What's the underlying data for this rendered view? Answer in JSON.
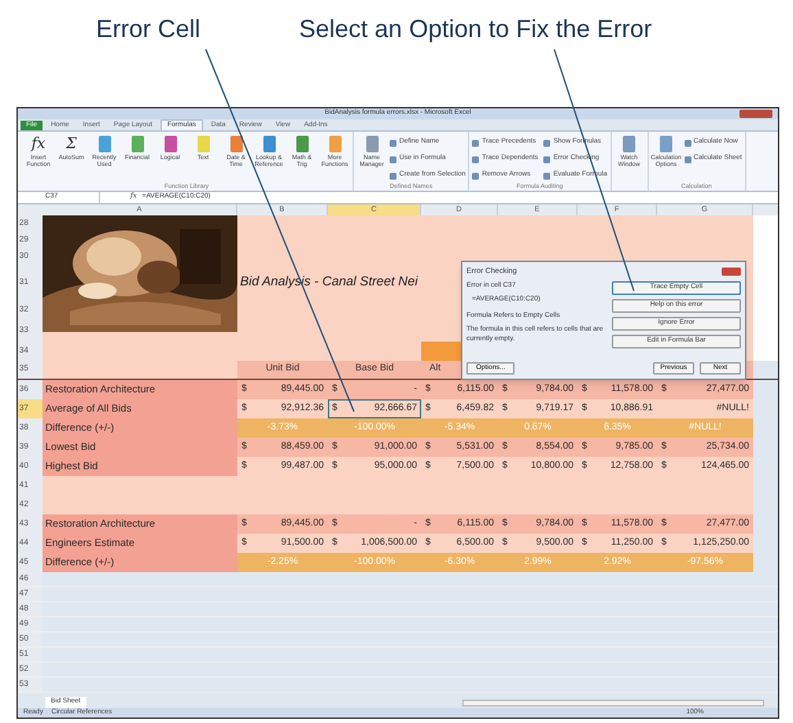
{
  "callouts": [
    "Error Cell",
    "Select an Option to Fix the Error"
  ],
  "window": {
    "title": "BidAnalysis formula errors.xlsx - Microsoft Excel"
  },
  "tabs": [
    {
      "label": "File",
      "selected": false,
      "kind": "file"
    },
    {
      "label": "Home",
      "selected": false,
      "kind": "tab"
    },
    {
      "label": "Insert",
      "selected": false,
      "kind": "tab"
    },
    {
      "label": "Page Layout",
      "selected": false,
      "kind": "tab"
    },
    {
      "label": "Formulas",
      "selected": true,
      "kind": "tab"
    },
    {
      "label": "Data",
      "selected": false,
      "kind": "tab"
    },
    {
      "label": "Review",
      "selected": false,
      "kind": "tab"
    },
    {
      "label": "View",
      "selected": false,
      "kind": "tab"
    },
    {
      "label": "Add-Ins",
      "selected": false,
      "kind": "tab"
    }
  ],
  "ribbon": {
    "groups": [
      {
        "label": "Function Library",
        "large": [
          {
            "glyph": "fx",
            "label": "Insert Function"
          },
          {
            "glyph": "Σ",
            "label": "AutoSum"
          },
          {
            "color": "#4aa3d8",
            "label": "Recently Used"
          },
          {
            "color": "#5bb05b",
            "label": "Financial"
          },
          {
            "color": "#c84fa0",
            "label": "Logical"
          },
          {
            "color": "#e8d84a",
            "label": "Text"
          },
          {
            "color": "#e8803a",
            "label": "Date & Time"
          },
          {
            "color": "#3d8fd0",
            "label": "Lookup & Reference"
          },
          {
            "color": "#4a9a4a",
            "label": "Math & Trig"
          },
          {
            "color": "#f0a040",
            "label": "More Functions"
          }
        ]
      },
      {
        "label": "Defined Names",
        "large": [
          {
            "color": "#8a9ab0",
            "label": "Name Manager"
          }
        ],
        "small": [
          "Define Name",
          "Use in Formula",
          "Create from Selection"
        ]
      },
      {
        "label": "Formula Auditing",
        "small": [
          "Trace Precedents",
          "Trace Dependents",
          "Remove Arrows",
          "Show Formulas",
          "Error Checking",
          "Evaluate Formula"
        ]
      },
      {
        "large": [
          {
            "color": "#7a9ac0",
            "label": "Watch Window"
          }
        ]
      },
      {
        "label": "Calculation",
        "large": [
          {
            "color": "#7aa0c8",
            "label": "Calculation Options"
          }
        ],
        "small": [
          "Calculate Now",
          "Calculate Sheet"
        ]
      }
    ]
  },
  "formula_bar": {
    "name_box": "C37",
    "fx": "fx",
    "formula": "=AVERAGE(C10:C20)"
  },
  "columns": [
    {
      "label": "A",
      "selected": false
    },
    {
      "label": "B",
      "selected": false
    },
    {
      "label": "C",
      "selected": true
    },
    {
      "label": "D",
      "selected": false
    },
    {
      "label": "E",
      "selected": false
    },
    {
      "label": "F",
      "selected": false
    },
    {
      "label": "G",
      "selected": false
    }
  ],
  "top_rows": [
    "28",
    "29",
    "30",
    "31",
    "32",
    "33",
    "34"
  ],
  "sheet_title": "Bid Analysis - Canal Street Nei",
  "header_row": {
    "row": "35",
    "cells": [
      "Unit Bid",
      "Base Bid",
      "Alt"
    ]
  },
  "rows": [
    {
      "row": "36",
      "kind": "salmon",
      "selected": false,
      "label": "Restoration Architecture",
      "cells": [
        [
          "$",
          "89,445.00"
        ],
        [
          "$",
          "-"
        ],
        [
          "$",
          "6,115.00"
        ],
        [
          "$",
          "9,784.00"
        ],
        [
          "$",
          "11,578.00"
        ],
        [
          "$",
          "27,477.00"
        ]
      ]
    },
    {
      "row": "37",
      "kind": "light",
      "selected": true,
      "label": "Average of All Bids",
      "cells": [
        [
          "$",
          "92,912.36"
        ],
        [
          "$",
          "92,666.67"
        ],
        [
          "$",
          "6,459.82"
        ],
        [
          "$",
          "9,719.17"
        ],
        [
          "$",
          "10,886.91"
        ],
        [
          "",
          "#NULL!"
        ]
      ]
    },
    {
      "row": "38",
      "kind": "orange",
      "selected": false,
      "label": "Difference (+/-)",
      "cells": [
        [
          "",
          "-3.73%"
        ],
        [
          "",
          "-100.00%"
        ],
        [
          "",
          "-5.34%"
        ],
        [
          "",
          "0.67%"
        ],
        [
          "",
          "6.35%"
        ],
        [
          "",
          "#NULL!"
        ]
      ]
    },
    {
      "row": "39",
      "kind": "salmon",
      "selected": false,
      "label": "Lowest Bid",
      "cells": [
        [
          "$",
          "88,459.00"
        ],
        [
          "$",
          "91,000.00"
        ],
        [
          "$",
          "5,531.00"
        ],
        [
          "$",
          "8,554.00"
        ],
        [
          "$",
          "9,785.00"
        ],
        [
          "$",
          "25,734.00"
        ]
      ]
    },
    {
      "row": "40",
      "kind": "light",
      "selected": false,
      "label": "Highest Bid",
      "cells": [
        [
          "$",
          "99,487.00"
        ],
        [
          "$",
          "95,000.00"
        ],
        [
          "$",
          "7,500.00"
        ],
        [
          "$",
          "10,800.00"
        ],
        [
          "$",
          "12,758.00"
        ],
        [
          "$",
          "124,465.00"
        ]
      ]
    },
    {
      "row": "41",
      "kind": "blank",
      "selected": false,
      "label": "",
      "cells": []
    },
    {
      "row": "42",
      "kind": "blank",
      "selected": false,
      "label": "",
      "cells": []
    },
    {
      "row": "43",
      "kind": "salmon",
      "selected": false,
      "label": "Restoration Architecture",
      "cells": [
        [
          "$",
          "89,445.00"
        ],
        [
          "$",
          "-"
        ],
        [
          "$",
          "6,115.00"
        ],
        [
          "$",
          "9,784.00"
        ],
        [
          "$",
          "11,578.00"
        ],
        [
          "$",
          "27,477.00"
        ]
      ]
    },
    {
      "row": "44",
      "kind": "light",
      "selected": false,
      "label": "Engineers Estimate",
      "cells": [
        [
          "$",
          "91,500.00"
        ],
        [
          "$",
          "1,006,500.00"
        ],
        [
          "$",
          "6,500.00"
        ],
        [
          "$",
          "9,500.00"
        ],
        [
          "$",
          "11,250.00"
        ],
        [
          "$",
          "1,125,250.00"
        ]
      ]
    },
    {
      "row": "45",
      "kind": "orange",
      "selected": false,
      "label": "Difference (+/-)",
      "cells": [
        [
          "",
          "-2.25%"
        ],
        [
          "",
          "-100.00%"
        ],
        [
          "",
          "-6.30%"
        ],
        [
          "",
          "2.99%"
        ],
        [
          "",
          "2.92%"
        ],
        [
          "",
          "-97.56%"
        ]
      ]
    }
  ],
  "empty_rows": [
    "46",
    "47",
    "48",
    "49",
    "50",
    "51",
    "52",
    "53"
  ],
  "dialog": {
    "title": "Error Checking",
    "error_in": "Error in cell C37",
    "formula": "=AVERAGE(C10:C20)",
    "heading": "Formula Refers to Empty Cells",
    "message": "The formula in this cell refers to cells that are currently empty.",
    "actions": [
      "Trace Empty Cell",
      "Help on this error",
      "Ignore Error",
      "Edit in Formula Bar"
    ],
    "options": "Options...",
    "nav": [
      "Previous",
      "Next"
    ]
  },
  "sheet_tabs": [
    "Bid Sheet"
  ],
  "status_bar": {
    "items": [
      "Ready",
      "Circular References"
    ],
    "zoom": "100%"
  }
}
